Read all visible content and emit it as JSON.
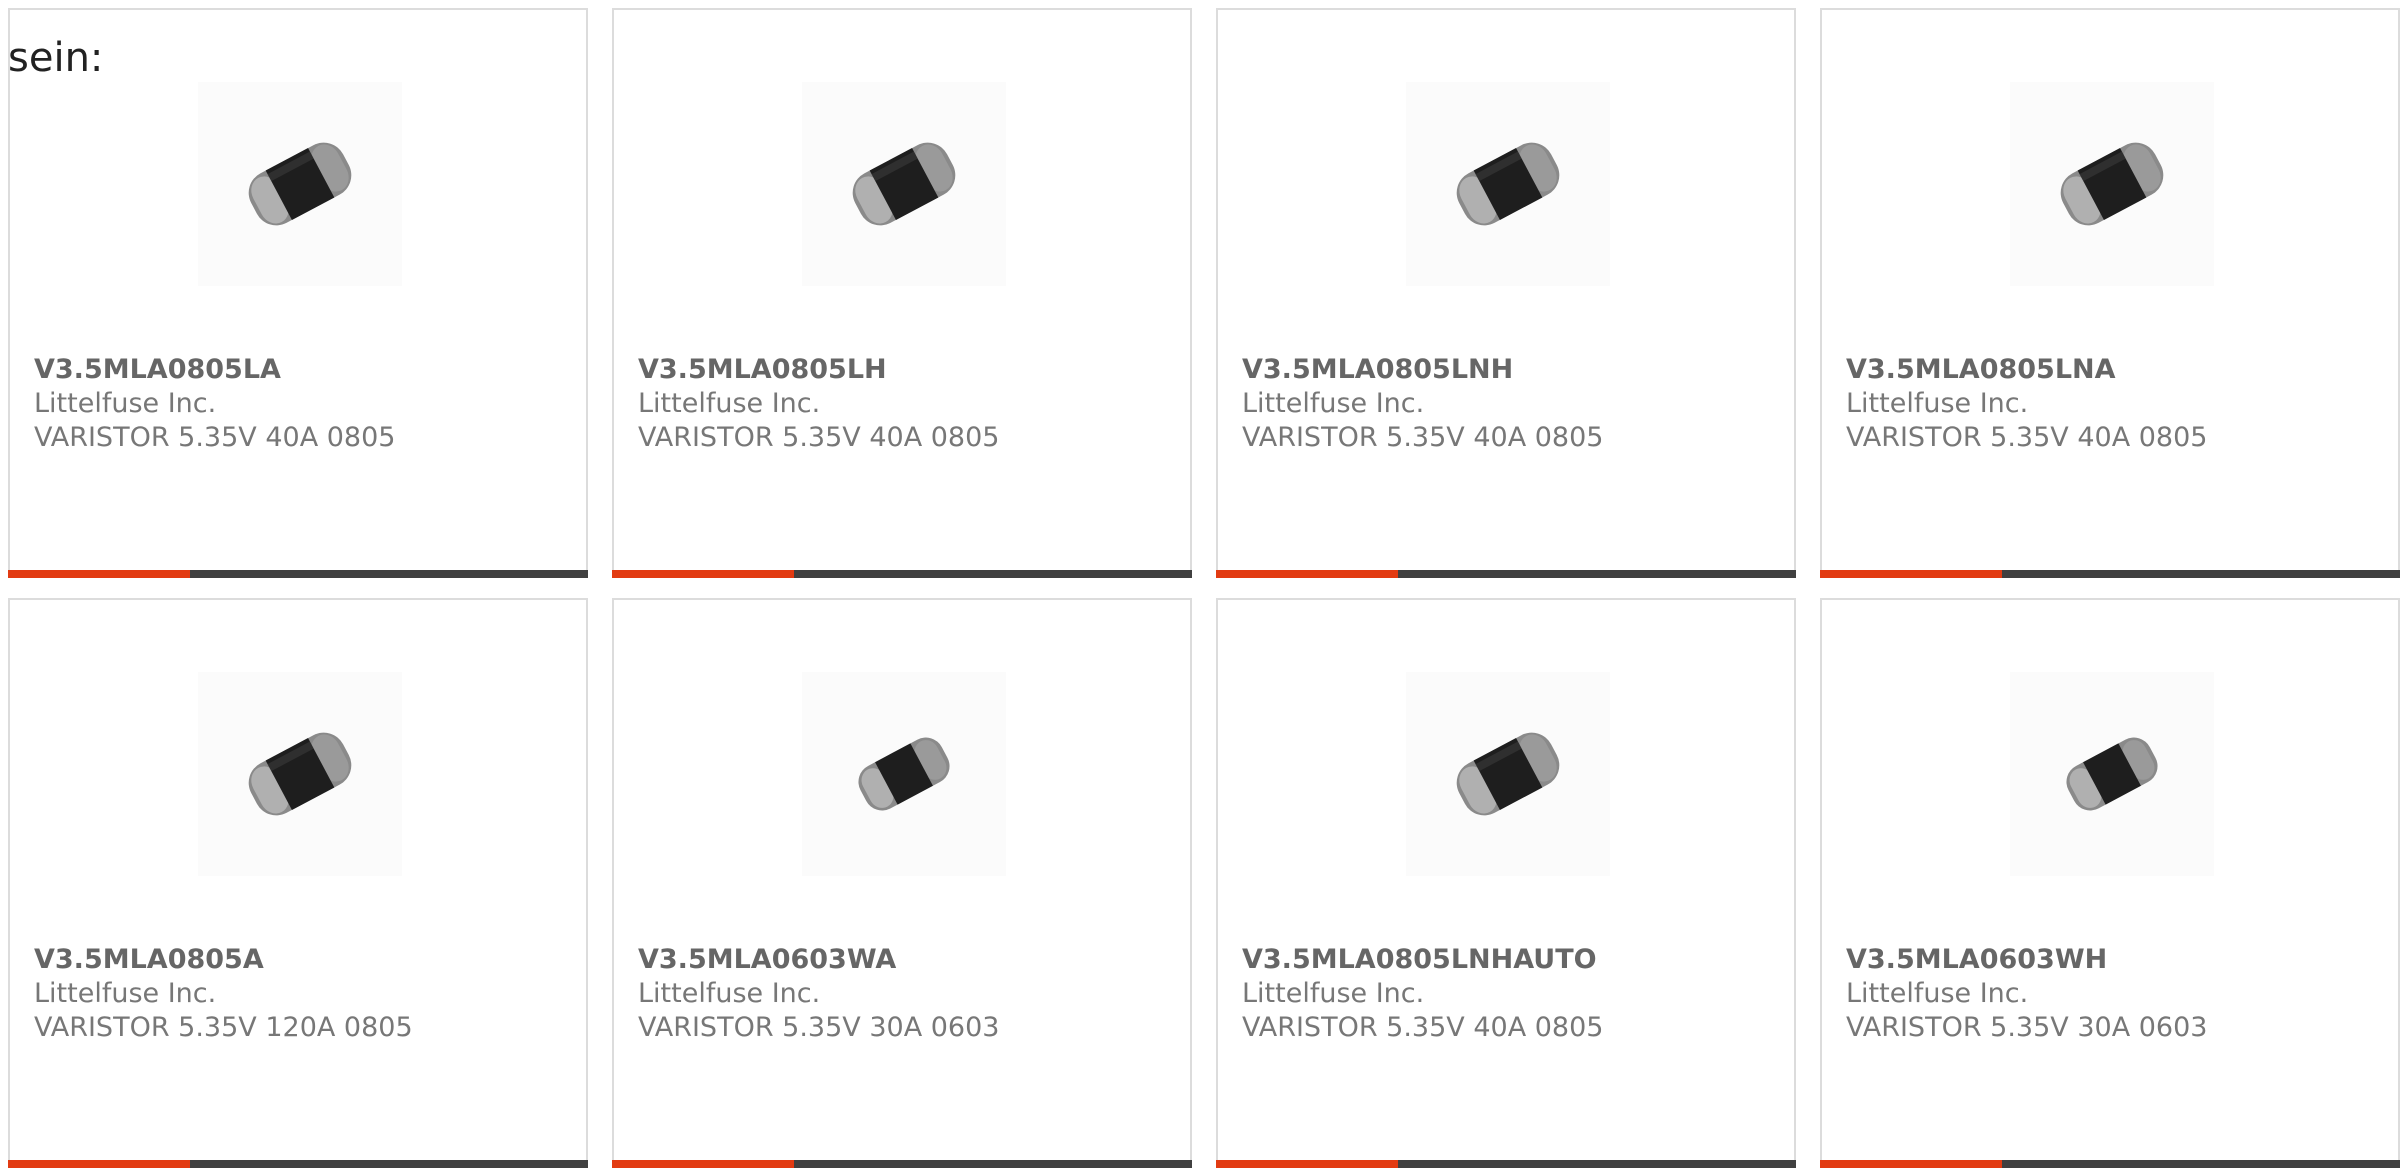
{
  "intro_text": "sein:",
  "colors": {
    "accent": "#e23b12",
    "bar": "#404040",
    "border": "#dcdcdc",
    "part_text": "#666666",
    "secondary_text": "#777777"
  },
  "products": [
    {
      "part": "V3.5MLA0805LA",
      "manufacturer": "Littelfuse Inc.",
      "description": "VARISTOR 5.35V 40A 0805",
      "icon": "varistor-chip-image"
    },
    {
      "part": "V3.5MLA0805LH",
      "manufacturer": "Littelfuse Inc.",
      "description": "VARISTOR 5.35V 40A 0805",
      "icon": "varistor-chip-image"
    },
    {
      "part": "V3.5MLA0805LNH",
      "manufacturer": "Littelfuse Inc.",
      "description": "VARISTOR 5.35V 40A 0805",
      "icon": "varistor-chip-image"
    },
    {
      "part": "V3.5MLA0805LNA",
      "manufacturer": "Littelfuse Inc.",
      "description": "VARISTOR 5.35V 40A 0805",
      "icon": "varistor-chip-image"
    },
    {
      "part": "V3.5MLA0805A",
      "manufacturer": "Littelfuse Inc.",
      "description": "VARISTOR 5.35V 120A 0805",
      "icon": "varistor-chip-image"
    },
    {
      "part": "V3.5MLA0603WA",
      "manufacturer": "Littelfuse Inc.",
      "description": "VARISTOR 5.35V 30A 0603",
      "icon": "varistor-chip-image"
    },
    {
      "part": "V3.5MLA0805LNHAUTO",
      "manufacturer": "Littelfuse Inc.",
      "description": "VARISTOR 5.35V 40A 0805",
      "icon": "varistor-chip-image"
    },
    {
      "part": "V3.5MLA0603WH",
      "manufacturer": "Littelfuse Inc.",
      "description": "VARISTOR 5.35V 30A 0603",
      "icon": "varistor-chip-image"
    }
  ]
}
